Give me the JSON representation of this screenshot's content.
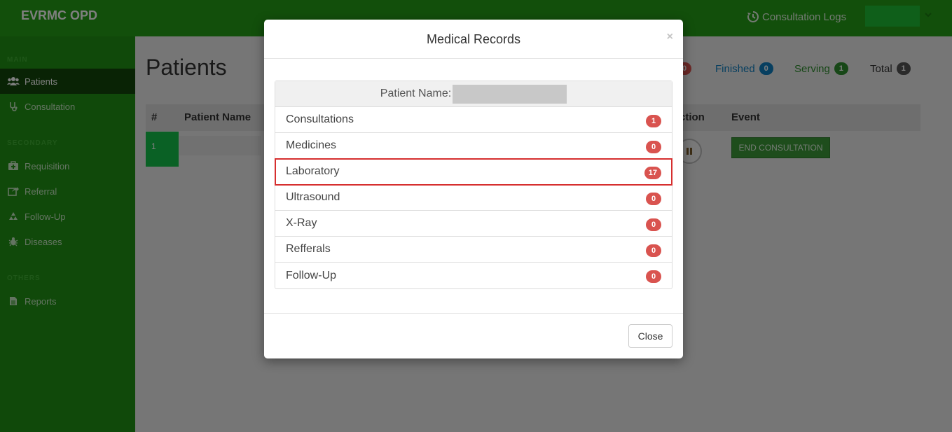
{
  "app": {
    "brand": "EVRMC OPD"
  },
  "topbar": {
    "logs_label": "Consultation Logs"
  },
  "sidebar": {
    "sections": [
      "MAIN",
      "SECONDARY",
      "OTHERS"
    ],
    "items": [
      {
        "label": "Patients",
        "icon": "users-icon",
        "active": true
      },
      {
        "label": "Consultation",
        "icon": "stethoscope-icon"
      },
      {
        "label": "Requisition",
        "icon": "medkit-icon"
      },
      {
        "label": "Referral",
        "icon": "share-icon"
      },
      {
        "label": "Follow-Up",
        "icon": "recycle-icon"
      },
      {
        "label": "Diseases",
        "icon": "bug-icon"
      },
      {
        "label": "Reports",
        "icon": "file-icon"
      }
    ]
  },
  "main": {
    "title": "Patients",
    "stats": [
      {
        "label": "",
        "count": "0",
        "color": "#d9534f"
      },
      {
        "label": "Finished",
        "count": "0",
        "color": "#0e7fc0"
      },
      {
        "label": "Serving",
        "count": "1",
        "color": "#2f8f2f"
      },
      {
        "label": "Total",
        "count": "1",
        "color": "#555555"
      }
    ],
    "table": {
      "headers": [
        "#",
        "Patient Name",
        "ction",
        "Event"
      ],
      "rows": [
        {
          "num": "1"
        }
      ]
    },
    "end_button": "END CONSULTATION"
  },
  "modal": {
    "title": "Medical Records",
    "close_x": "×",
    "patient_label": "Patient Name:",
    "records": [
      {
        "label": "Consultations",
        "count": "1"
      },
      {
        "label": "Medicines",
        "count": "0"
      },
      {
        "label": "Laboratory",
        "count": "17"
      },
      {
        "label": "Ultrasound",
        "count": "0"
      },
      {
        "label": "X-Ray",
        "count": "0"
      },
      {
        "label": "Refferals",
        "count": "0"
      },
      {
        "label": "Follow-Up",
        "count": "0"
      }
    ],
    "close_label": "Close"
  }
}
